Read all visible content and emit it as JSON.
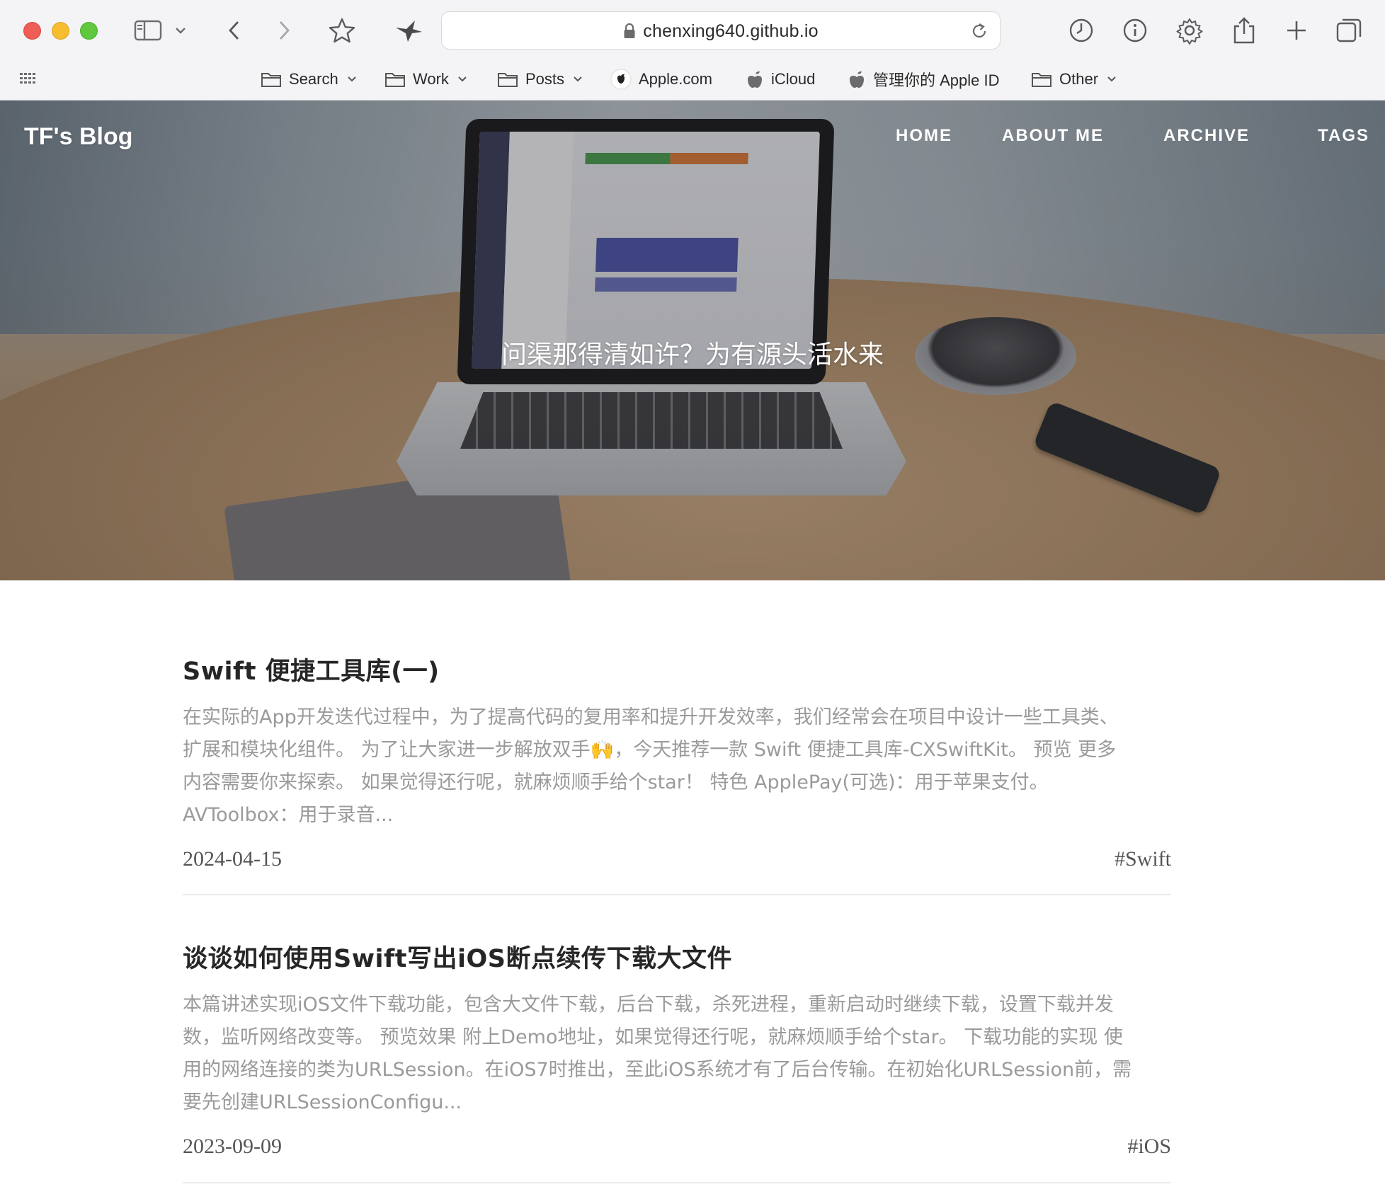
{
  "browser": {
    "url": "chenxing640.github.io",
    "bookmarks": [
      {
        "label": "Search",
        "kind": "folder",
        "dropdown": true
      },
      {
        "label": "Work",
        "kind": "folder",
        "dropdown": true
      },
      {
        "label": "Posts",
        "kind": "folder",
        "dropdown": true
      },
      {
        "label": "Apple.com",
        "kind": "apple",
        "dropdown": false
      },
      {
        "label": "iCloud",
        "kind": "apple",
        "dropdown": false
      },
      {
        "label": "管理你的 Apple ID",
        "kind": "apple",
        "dropdown": false
      },
      {
        "label": "Other",
        "kind": "folder",
        "dropdown": true
      }
    ]
  },
  "blog": {
    "brand": "TF's Blog",
    "nav": [
      "HOME",
      "ABOUT ME",
      "ARCHIVE",
      "TAGS"
    ],
    "hero_title": "问渠那得清如许？为有源头活水来"
  },
  "posts": [
    {
      "title": "Swift 便捷工具库(一)",
      "excerpt_lines": [
        "在实际的App开发迭代过程中，为了提高代码的复用率和提升开发效率，我们经常会在项目中设计一些工具类、",
        "扩展和模块化组件。 为了让大家进一步解放双手🙌，今天推荐一款 Swift 便捷工具库-CXSwiftKit。 预览 更多",
        "内容需要你来探索。 如果觉得还行呢，就麻烦顺手给个star！ 特色 ApplePay(可选)：用于苹果支付。",
        "AVToolbox：用于录音..."
      ],
      "date": "2024-04-15",
      "tag": "#Swift"
    },
    {
      "title": "谈谈如何使用Swift写出iOS断点续传下载大文件",
      "excerpt_lines": [
        "本篇讲述实现iOS文件下载功能，包含大文件下载，后台下载，杀死进程，重新启动时继续下载，设置下载并发",
        "数，监听网络改变等。 预览效果 附上Demo地址，如果觉得还行呢，就麻烦顺手给个star。 下载功能的实现 使",
        "用的网络连接的类为URLSession。在iOS7时推出，至此iOS系统才有了后台传输。在初始化URLSession前，需",
        "要先创建URLSessionConfigu..."
      ],
      "date": "2023-09-09",
      "tag": "#iOS"
    }
  ]
}
